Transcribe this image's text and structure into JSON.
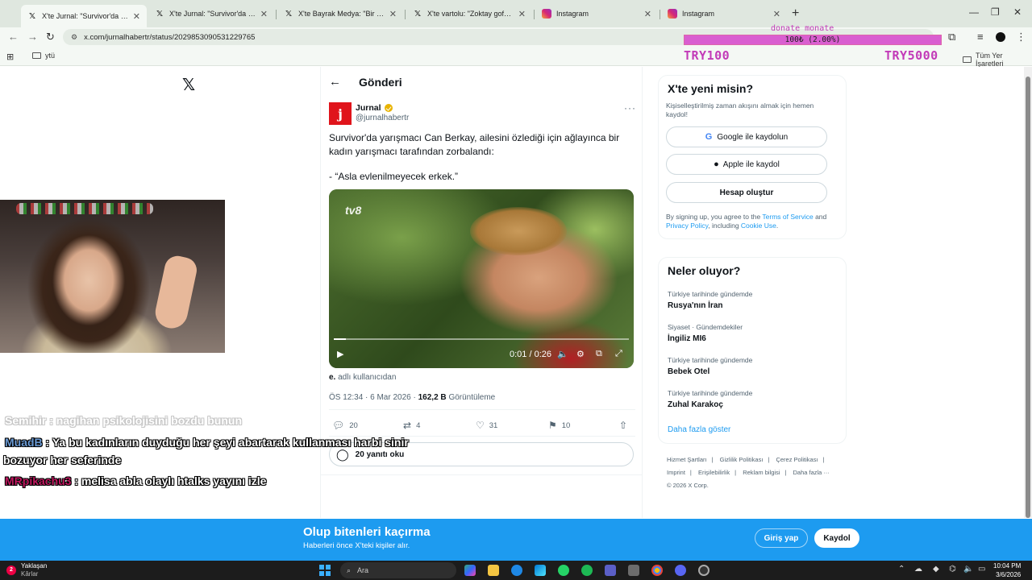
{
  "browser": {
    "tabs": [
      {
        "title": "X'te Jurnal: \"Survivor'da yarışma...",
        "favicon": "x-logo-icon",
        "active": true
      },
      {
        "title": "X'te Jurnal: \"Survivor'da ailesini...",
        "favicon": "x-logo-icon",
        "active": false
      },
      {
        "title": "X'te Bayrak Medya: \"Bir kadın, ...",
        "favicon": "x-logo-icon",
        "active": false
      },
      {
        "title": "X'te vartolu: \"Zoktay gofret rek...",
        "favicon": "x-logo-icon",
        "active": false
      },
      {
        "title": "Instagram",
        "favicon": "instagram-icon",
        "active": false
      },
      {
        "title": "Instagram",
        "favicon": "instagram-icon",
        "active": false
      }
    ],
    "url": "x.com/jurnalhabertr/status/2029853090531229765",
    "bookmarks": {
      "left": "ytü",
      "right": "Tüm Yer İşaretleri"
    }
  },
  "donation": {
    "title": "donate monate",
    "progress_text": "100₺ (2.00%)",
    "progress_fraction": 0.02,
    "min": "TRY100",
    "max": "TRY5000",
    "color": "#d95ed0"
  },
  "post": {
    "header": "Gönderi",
    "author": {
      "name": "Jurnal",
      "handle": "@jurnalhabertr",
      "avatar_letter": "j",
      "avatar_color": "#e0141b"
    },
    "text_line1": "Survivor'da yarışmacı Can Berkay, ailesini özlediği için ağlayınca bir kadın yarışmacı tarafından zorbalandı:",
    "text_line2": "- “Asla evlenilmeyecek erkek.”",
    "video": {
      "watermark": "tv8",
      "time": "0:01 / 0:26",
      "progress_fraction": 0.04
    },
    "alt_note_user": "e.",
    "alt_note_rest": "adlı kullanıcıdan",
    "timestamp": "ÖS 12:34 · 6 Mar 2026 · ",
    "views": "162,2 B",
    "views_label": "Görüntüleme",
    "actions": {
      "replies": "20",
      "reposts": "4",
      "likes": "31",
      "bookmarks": "10"
    },
    "read_replies": "20 yanıtı oku"
  },
  "signup_card": {
    "title": "X'te yeni misin?",
    "subtitle": "Kişiselleştirilmiş zaman akışını almak için hemen kaydol!",
    "google": "Google ile kaydolun",
    "apple": "Apple ile kaydol",
    "create": "Hesap oluştur",
    "legal_pre": "By signing up, you agree to the ",
    "terms": "Terms of Service",
    "legal_mid": " and ",
    "privacy": "Privacy Policy",
    "legal_mid2": ", including ",
    "cookie": "Cookie Use",
    "legal_end": "."
  },
  "trends": {
    "title": "Neler oluyor?",
    "items": [
      {
        "category": "Türkiye tarihinde gündemde",
        "name": "Rusya'nın İran"
      },
      {
        "category": "Siyaset · Gündemdekiler",
        "name": "İngiliz MI6"
      },
      {
        "category": "Türkiye tarihinde gündemde",
        "name": "Bebek Otel"
      },
      {
        "category": "Türkiye tarihinde gündemde",
        "name": "Zuhal Karakoç"
      }
    ],
    "show_more": "Daha fazla göster"
  },
  "footer": {
    "links": [
      "Hizmet Şartları",
      "|",
      "Gizlilik Politikası",
      "|",
      "Çerez Politikası",
      "|",
      "Imprint",
      "|",
      "Erişilebilirlik",
      "|",
      "Reklam bilgisi",
      "|",
      "Daha fazla ···"
    ],
    "copyright": "© 2026 X Corp."
  },
  "chat": {
    "faded": "Semihir : nagihan psikolojisini bozdu bunun",
    "line1_user": "MuadB",
    "line1_text": " : Ya bu kadınların duyduğu her şeyi abartarak kullanması harbi sinir",
    "line1_cont": "bozuyor her seferinde",
    "line2_user": "MRpikachu3",
    "line2_text": " : melisa abla olaylı htalks yayını izle"
  },
  "banner": {
    "title": "Olup bitenleri kaçırma",
    "subtitle": "Haberleri önce X'teki kişiler alır.",
    "login": "Giriş yap",
    "signup": "Kaydol"
  },
  "taskbar": {
    "weather_title": "Yaklaşan",
    "weather_sub": "Kârlar",
    "weather_badge": "2",
    "search": "Ara",
    "time": "10:04 PM",
    "date": "3/6/2026"
  }
}
